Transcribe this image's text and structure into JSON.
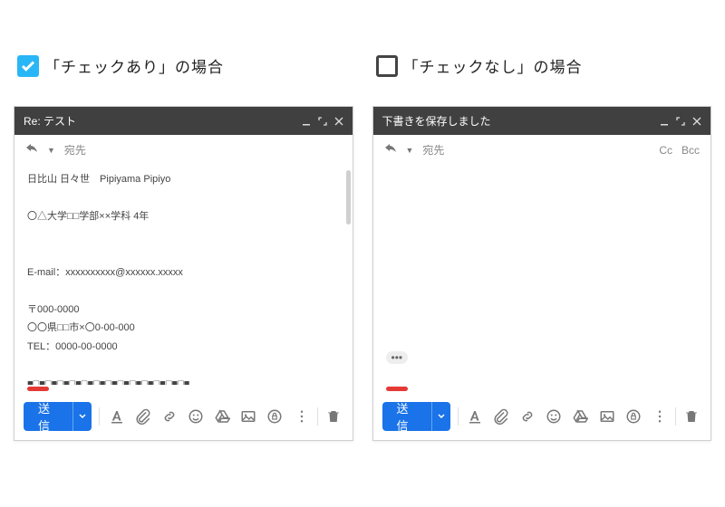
{
  "left": {
    "caption": "「チェックあり」の場合",
    "window_title": "Re: テスト",
    "recipient_label": "宛先",
    "body_lines": [
      "日比山 日々世　Pipiyama Pipiyo",
      "",
      "〇△大学□□学部××学科 4年",
      "",
      "",
      "E-mail：xxxxxxxxxx@xxxxxx.xxxxx",
      "",
      "〒000-0000",
      "〇〇県□□市×〇0-00-000",
      "TEL：0000-00-0000",
      "",
      "■□■□■□■□■□■□■□■□■□■□■□■□■□■"
    ],
    "quoted_toggle": "•••",
    "send_label": "送信"
  },
  "right": {
    "caption": "「チェックなし」の場合",
    "window_title": "下書きを保存しました",
    "recipient_label": "宛先",
    "cc_label": "Cc",
    "bcc_label": "Bcc",
    "quoted_toggle": "•••",
    "send_label": "送信"
  }
}
